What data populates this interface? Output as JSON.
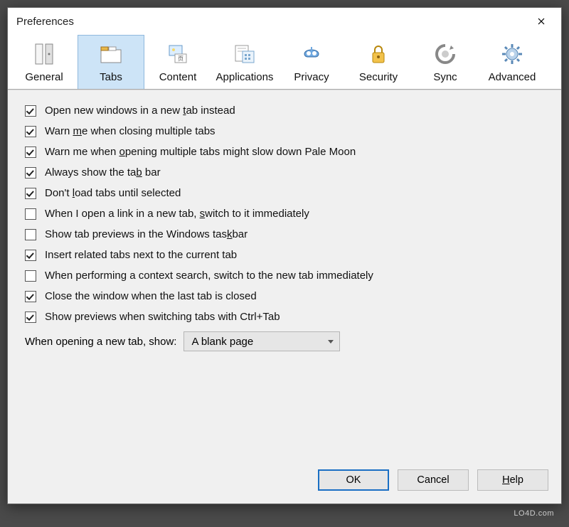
{
  "window": {
    "title": "Preferences"
  },
  "tabs": {
    "general": {
      "label": "General"
    },
    "tabs": {
      "label": "Tabs"
    },
    "content": {
      "label": "Content"
    },
    "applications": {
      "label": "Applications"
    },
    "privacy": {
      "label": "Privacy"
    },
    "security": {
      "label": "Security"
    },
    "sync": {
      "label": "Sync"
    },
    "advanced": {
      "label": "Advanced"
    }
  },
  "options": {
    "newWindowsInTab": {
      "checked": true,
      "label": "Open new windows in a new tab instead",
      "accel": "t"
    },
    "warnCloseMultiple": {
      "checked": true,
      "label": "Warn me when closing multiple tabs",
      "accel": "m"
    },
    "warnOpenMultiple": {
      "checked": true,
      "label": "Warn me when opening multiple tabs might slow down Pale Moon",
      "accel": "o"
    },
    "alwaysShowTabBar": {
      "checked": true,
      "label": "Always show the tab bar",
      "accel": "b"
    },
    "dontLoadUntilSel": {
      "checked": true,
      "label": "Don't load tabs until selected",
      "accel": "l"
    },
    "switchOnOpen": {
      "checked": false,
      "label": "When I open a link in a new tab, switch to it immediately",
      "accel": "s"
    },
    "taskbarPreviews": {
      "checked": false,
      "label": "Show tab previews in the Windows taskbar",
      "accel": "k"
    },
    "insertRelated": {
      "checked": true,
      "label": "Insert related tabs next to the current tab"
    },
    "contextSearchSwitch": {
      "checked": false,
      "label": "When performing a context search, switch to the new tab immediately"
    },
    "closeWindowLastTab": {
      "checked": true,
      "label": "Close the window when the last tab is closed"
    },
    "ctrlTabPreviews": {
      "checked": true,
      "label": "Show previews when switching tabs with Ctrl+Tab"
    }
  },
  "newTabShow": {
    "label": "When opening a new tab, show:",
    "value": "A blank page"
  },
  "buttons": {
    "ok": "OK",
    "cancel": "Cancel",
    "help": "Help"
  },
  "watermark": "LO4D.com"
}
